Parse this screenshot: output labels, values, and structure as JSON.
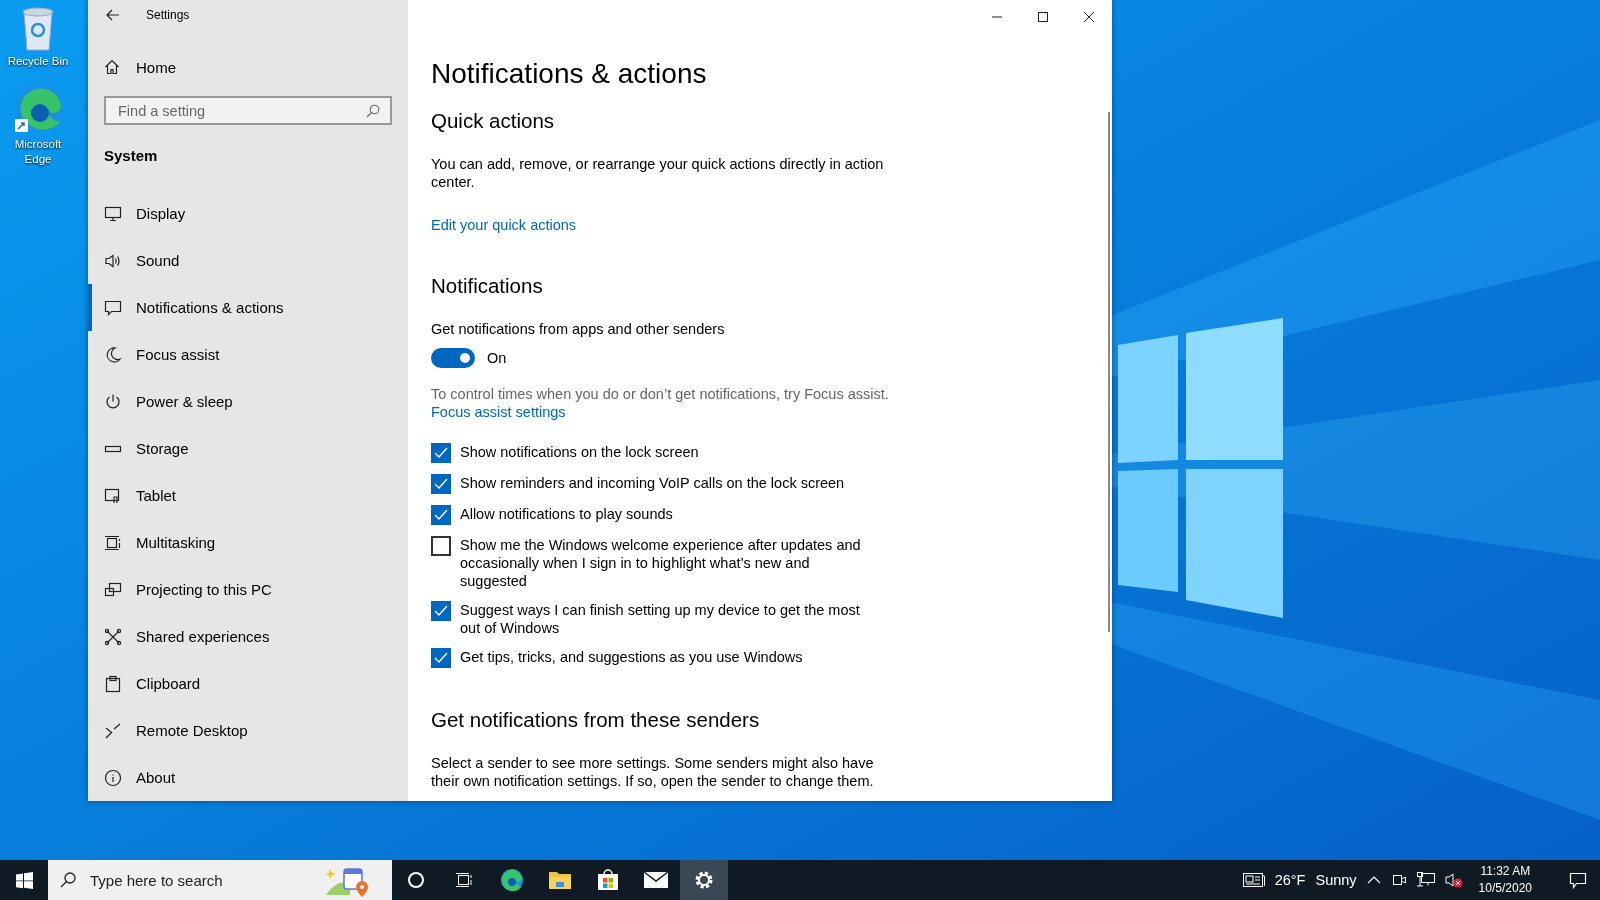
{
  "desktop_icons": [
    {
      "kind": "recycle-bin",
      "label": "Recycle Bin"
    },
    {
      "kind": "edge",
      "label": "Microsoft Edge"
    }
  ],
  "window": {
    "title": "Settings"
  },
  "sidebar": {
    "home": "Home",
    "search": {
      "placeholder": "Find a setting"
    },
    "section": "System",
    "items": [
      {
        "kind": "display",
        "label": "Display",
        "selected": false
      },
      {
        "kind": "sound",
        "label": "Sound",
        "selected": false
      },
      {
        "kind": "chat",
        "label": "Notifications & actions",
        "selected": true
      },
      {
        "kind": "moon",
        "label": "Focus assist",
        "selected": false
      },
      {
        "kind": "power",
        "label": "Power & sleep",
        "selected": false
      },
      {
        "kind": "storage",
        "label": "Storage",
        "selected": false
      },
      {
        "kind": "tablet",
        "label": "Tablet",
        "selected": false
      },
      {
        "kind": "multitask",
        "label": "Multitasking",
        "selected": false
      },
      {
        "kind": "project",
        "label": "Projecting to this PC",
        "selected": false
      },
      {
        "kind": "share",
        "label": "Shared experiences",
        "selected": false
      },
      {
        "kind": "clipboard",
        "label": "Clipboard",
        "selected": false
      },
      {
        "kind": "remote",
        "label": "Remote Desktop",
        "selected": false
      },
      {
        "kind": "info",
        "label": "About",
        "selected": false
      }
    ]
  },
  "content": {
    "title": "Notifications & actions",
    "quick_actions": {
      "heading": "Quick actions",
      "text": "You can add, remove, or rearrange your quick actions directly in action center.",
      "link": "Edit your quick actions"
    },
    "notifications": {
      "heading": "Notifications",
      "label": "Get notifications from apps and other senders",
      "toggle": {
        "on": true,
        "state_text": "On"
      },
      "hint": "To control times when you do or don’t get notifications, try Focus assist.",
      "link": "Focus assist settings",
      "checkboxes": [
        {
          "label": "Show notifications on the lock screen",
          "checked": true
        },
        {
          "label": "Show reminders and incoming VoIP calls on the lock screen",
          "checked": true
        },
        {
          "label": "Allow notifications to play sounds",
          "checked": true
        },
        {
          "label": "Show me the Windows welcome experience after updates and occasionally when I sign in to highlight what’s new and suggested",
          "checked": false
        },
        {
          "label": "Suggest ways I can finish setting up my device to get the most out of Windows",
          "checked": true
        },
        {
          "label": "Get tips, tricks, and suggestions as you use Windows",
          "checked": true
        }
      ]
    },
    "senders": {
      "heading": "Get notifications from these senders",
      "text": "Select a sender to see more settings. Some senders might also have their own notification settings. If so, open the sender to change them."
    }
  },
  "taskbar": {
    "search": {
      "placeholder": "Type here to search"
    },
    "apps": [
      {
        "kind": "cortana",
        "selected": false
      },
      {
        "kind": "task-view",
        "selected": false
      },
      {
        "kind": "edge",
        "selected": false
      },
      {
        "kind": "folder",
        "selected": false
      },
      {
        "kind": "store",
        "selected": false
      },
      {
        "kind": "mail",
        "selected": false
      },
      {
        "kind": "gear",
        "selected": true
      }
    ],
    "weather": {
      "temperature": "26°F",
      "condition": "Sunny"
    },
    "clock": {
      "time": "11:32 AM",
      "date": "10/5/2020"
    }
  }
}
